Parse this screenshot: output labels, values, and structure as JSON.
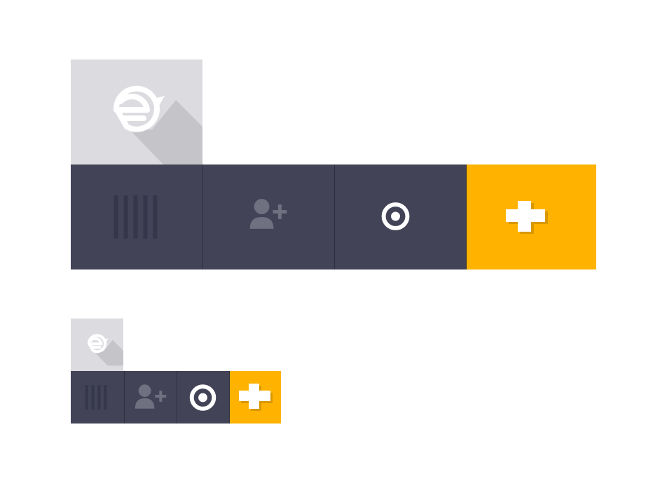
{
  "colors": {
    "logo_tile_bg": "#dcdce0",
    "button_bg": "#424357",
    "accent": "#ffb300",
    "icon_white": "#ffffff",
    "icon_muted": "#6f7080",
    "divider": "#2e2f3c"
  },
  "toolbars": [
    {
      "size": "large",
      "logo_icon": "logo-icon",
      "buttons": [
        {
          "icon": "barcode-icon",
          "style": "dark"
        },
        {
          "icon": "add-user-icon",
          "style": "dark"
        },
        {
          "icon": "target-icon",
          "style": "dark"
        },
        {
          "icon": "plus-icon",
          "style": "accent"
        }
      ]
    },
    {
      "size": "small",
      "logo_icon": "logo-icon",
      "buttons": [
        {
          "icon": "barcode-icon",
          "style": "dark"
        },
        {
          "icon": "add-user-icon",
          "style": "dark"
        },
        {
          "icon": "target-icon",
          "style": "dark"
        },
        {
          "icon": "plus-icon",
          "style": "accent"
        }
      ]
    }
  ]
}
